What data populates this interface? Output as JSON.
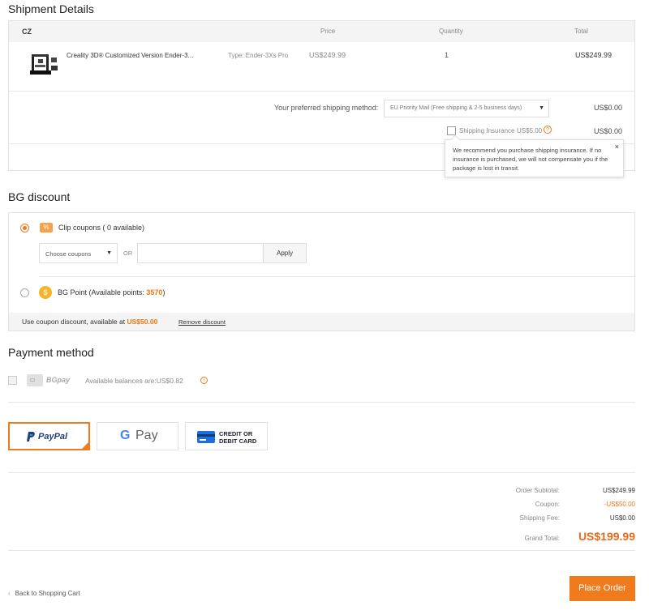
{
  "shipment": {
    "title": "Shipment Details",
    "warehouse": "CZ",
    "col_price": "Price",
    "col_quantity": "Quantity",
    "col_total": "Total",
    "product_name": "Creality 3D® Customized Version Ender-3...",
    "product_type": "Type: Ender-3Xs Pro",
    "product_price": "US$249.99",
    "product_qty": "1",
    "product_total": "US$249.99",
    "shipping_label": "Your preferred shipping method:",
    "shipping_option": "EU Priority Mail (Free shipping & 2-5 business days)",
    "shipping_cost": "US$0.00",
    "insurance_label": "Shipping Insurance",
    "insurance_price": "US$5.00",
    "insurance_cost": "US$0.00",
    "insurance_tooltip": "We recommend you purchase shipping insurance. If no insurance is purchased, we will not compensate you if the package is lost in transit.",
    "tooltip_close": "×"
  },
  "discount": {
    "title": "BG discount",
    "clip_label": "Clip coupons ( 0 available)",
    "choose_coupons": "Choose coupons",
    "or": "OR",
    "coupon_placeholder": "",
    "apply": "Apply",
    "bgpoint_prefix": "BG Point (Available points: ",
    "bgpoint_value": "3570",
    "bgpoint_suffix": ")",
    "use_coupon_prefix": "Use coupon discount, available at ",
    "use_coupon_amount": "US$50.00",
    "remove": "Remove discount",
    "clip_icon_text": "%"
  },
  "payment": {
    "title": "Payment method",
    "bgpay": "BGpay",
    "balance": "Available balances are:US$0.82",
    "paypal": "PayPal",
    "gpay_g": "G",
    "gpay_pay": "Pay",
    "card_line1": "CREDIT OR",
    "card_line2": "DEBIT CARD"
  },
  "summary": {
    "subtotal_label": "Order Subtotal:",
    "subtotal_value": "US$249.99",
    "coupon_label": "Coupon:",
    "coupon_value": "-US$50.00",
    "shipping_label": "Shipping Fee:",
    "shipping_value": "US$0.00",
    "grand_label": "Grand Total:",
    "grand_value": "US$199.99"
  },
  "footer": {
    "back": "Back to Shopping Cart",
    "place_order": "Place Order"
  },
  "colors": {
    "accent": "#f07b1d",
    "brand_orange": "#e56a1c",
    "paypal_blue": "#253b80",
    "card_blue": "#1e6fd9"
  }
}
